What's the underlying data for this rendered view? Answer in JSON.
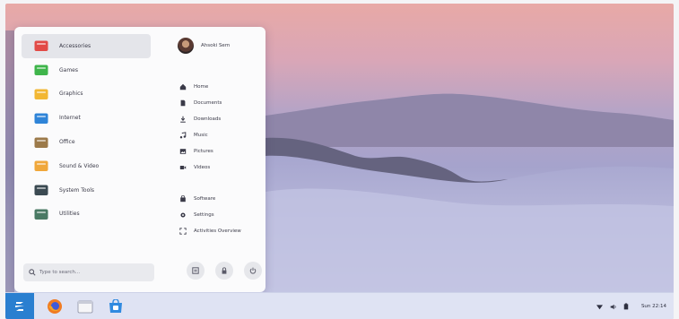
{
  "menu": {
    "categories": [
      {
        "label": "Accessories",
        "color": "#e24a46",
        "active": true
      },
      {
        "label": "Games",
        "color": "#3fb54b",
        "active": false
      },
      {
        "label": "Graphics",
        "color": "#f2b733",
        "active": false
      },
      {
        "label": "Internet",
        "color": "#2f84d8",
        "active": false
      },
      {
        "label": "Office",
        "color": "#9c7a4a",
        "active": false
      },
      {
        "label": "Sound & Video",
        "color": "#f0a73a",
        "active": false
      },
      {
        "label": "System Tools",
        "color": "#3b4a52",
        "active": false
      },
      {
        "label": "Utilities",
        "color": "#4a7a64",
        "active": false
      }
    ],
    "search_placeholder": "Type to search...",
    "user_name": "Ahsoki Sem",
    "places": [
      {
        "label": "Home",
        "icon": "home-icon"
      },
      {
        "label": "Documents",
        "icon": "documents-icon"
      },
      {
        "label": "Downloads",
        "icon": "downloads-icon"
      },
      {
        "label": "Music",
        "icon": "music-icon"
      },
      {
        "label": "Pictures",
        "icon": "pictures-icon"
      },
      {
        "label": "Videos",
        "icon": "videos-icon"
      }
    ],
    "system_items": [
      {
        "label": "Software",
        "icon": "software-icon"
      },
      {
        "label": "Settings",
        "icon": "settings-icon"
      },
      {
        "label": "Activities Overview",
        "icon": "activities-icon"
      }
    ],
    "actions": [
      "session-icon",
      "lock-icon",
      "power-icon"
    ]
  },
  "taskbar": {
    "start_icon": "zorin-logo-icon",
    "apps": [
      "firefox-icon",
      "files-icon",
      "software-store-icon"
    ],
    "tray_icons": [
      "network-icon",
      "volume-icon",
      "battery-icon"
    ],
    "clock": "Sun 22:14"
  },
  "colors": {
    "accent": "#2a7fd0",
    "menu_bg": "#fbfbfc",
    "taskbar_bg": "#dfe3f3"
  }
}
